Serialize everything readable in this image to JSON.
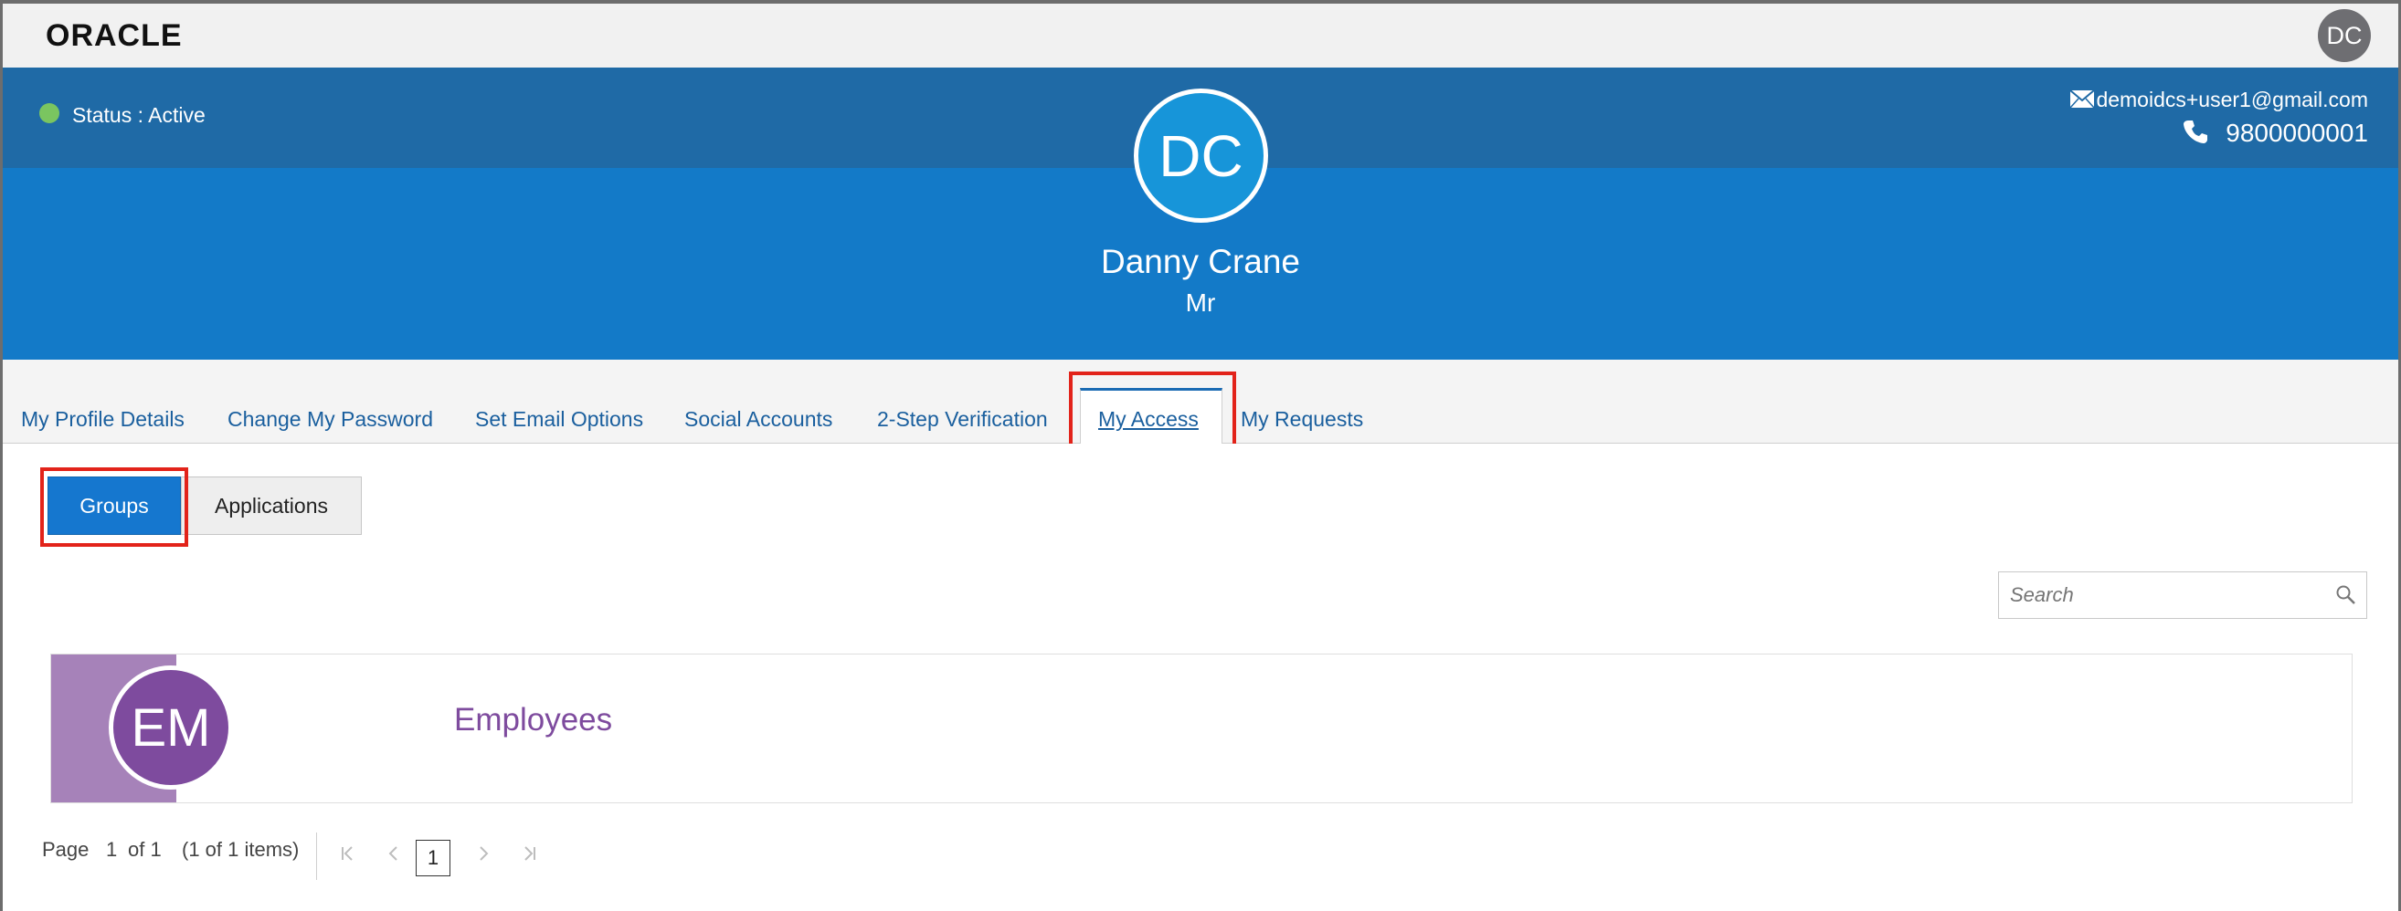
{
  "brand": {
    "logo_text": "ORACLE",
    "avatar_initials": "DC"
  },
  "profile": {
    "status_label": "Status : Active",
    "status_color": "#7ac560",
    "email": "demoidcs+user1@gmail.com",
    "phone": "9800000001",
    "initials": "DC",
    "name": "Danny Crane",
    "title": "Mr"
  },
  "tabs": [
    {
      "label": "My Profile Details",
      "active": false
    },
    {
      "label": "Change My Password",
      "active": false
    },
    {
      "label": "Set Email Options",
      "active": false
    },
    {
      "label": "Social Accounts",
      "active": false
    },
    {
      "label": "2-Step Verification",
      "active": false
    },
    {
      "label": "My Access",
      "active": true
    },
    {
      "label": "My Requests",
      "active": false
    }
  ],
  "access": {
    "toggle": {
      "groups_label": "Groups",
      "applications_label": "Applications",
      "selected": "Groups"
    },
    "search": {
      "placeholder": "Search",
      "value": ""
    },
    "items": [
      {
        "initials": "EM",
        "name": "Employees",
        "color": "#7e4b9e"
      }
    ],
    "pager": {
      "page_label": "Page",
      "current_page": "1",
      "of_label": "of 1",
      "items_label": "(1 of 1 items)",
      "current_button": "1"
    }
  },
  "colors": {
    "header_dark": "#1f6aa6",
    "header_blue": "#137ac8",
    "primary_button": "#1577cf",
    "highlight": "#e2231a"
  }
}
